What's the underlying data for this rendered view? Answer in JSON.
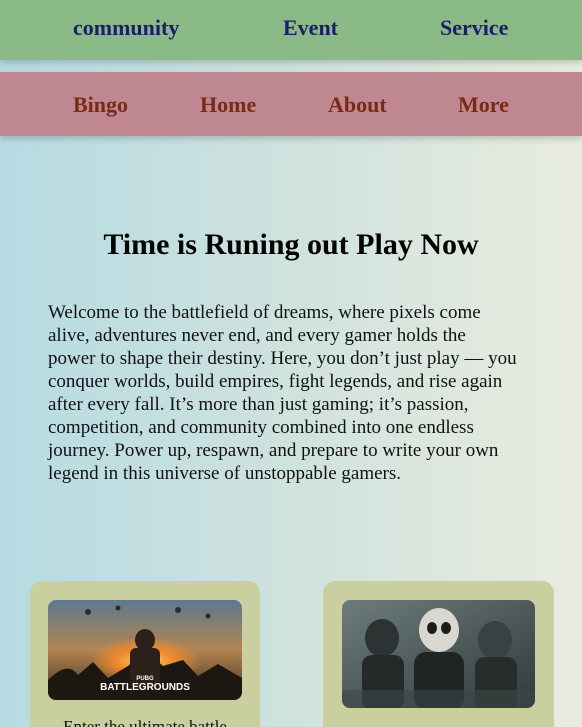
{
  "topnav": {
    "items": [
      {
        "label": "community"
      },
      {
        "label": "Event"
      },
      {
        "label": "Service"
      }
    ]
  },
  "subnav": {
    "items": [
      {
        "label": "Bingo"
      },
      {
        "label": "Home"
      },
      {
        "label": "About"
      },
      {
        "label": "More"
      }
    ]
  },
  "hero": {
    "title": "Time is Runing out Play Now",
    "paragraph": "Welcome to the battlefield of dreams, where pixels come alive, adventures never end, and every gamer holds the power to shape their destiny. Here, you don’t just play — you conquer worlds, build empires, fight legends, and rise again after every fall. It’s more than just gaming; it’s passion, competition, and community combined into one endless journey. Power up, respawn, and prepare to write your own legend in this universe of unstoppable gamers."
  },
  "cards": [
    {
      "logo_small": "PUBG",
      "logo_big": "BATTLEGROUNDS",
      "caption": "Enter the ultimate battle"
    },
    {
      "caption": ""
    }
  ],
  "colors": {
    "topnav_bg": "#8abb87",
    "topnav_text": "#1c1c6b",
    "subnav_bg": "#bf878f",
    "subnav_text": "#7a2a14",
    "card_bg": "#c9cf9f"
  }
}
